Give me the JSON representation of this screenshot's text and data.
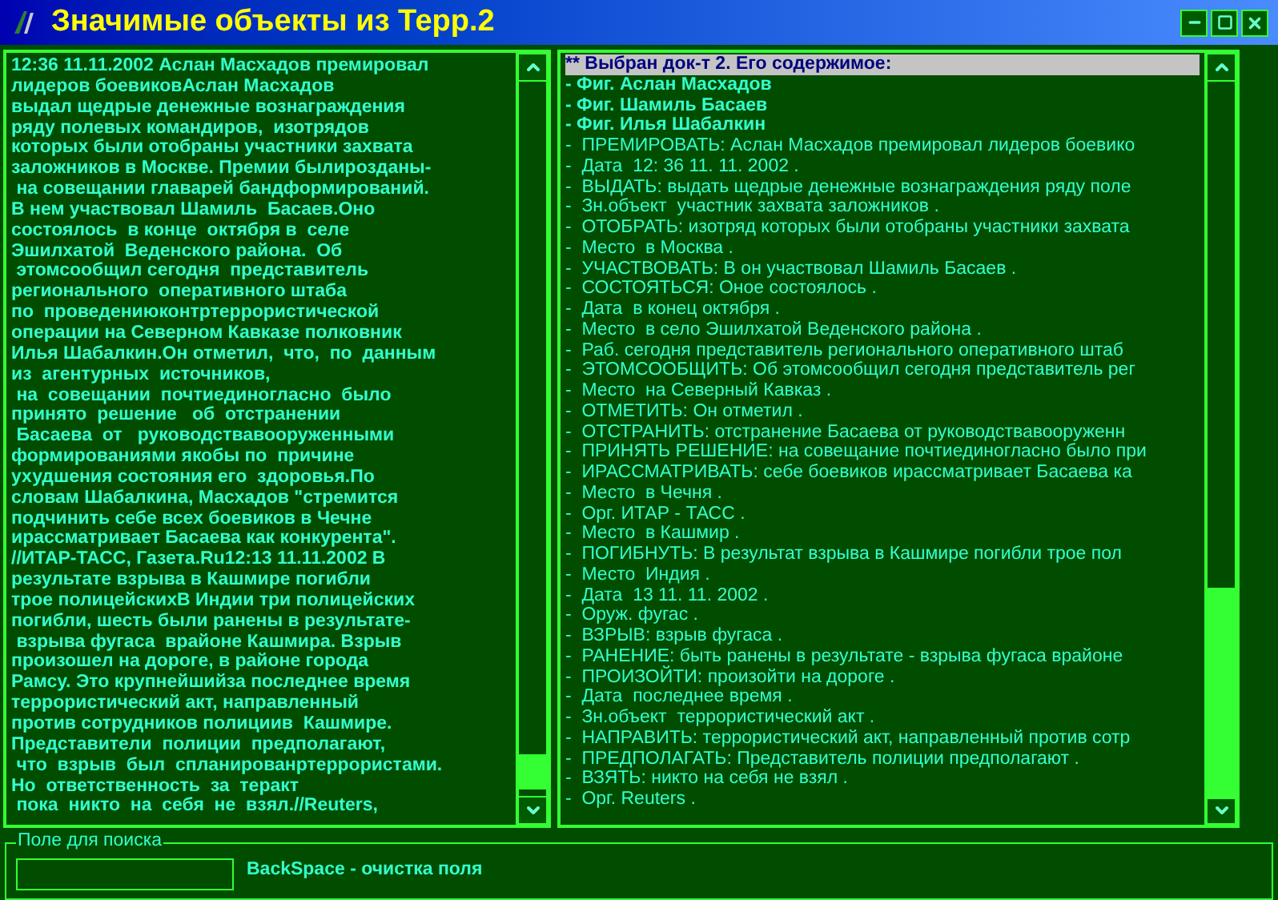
{
  "window": {
    "title": "Значимые объекты из Терр.2"
  },
  "document_text": [
    "12:36 11.11.2002 Аслан Масхадов премировал",
    "лидеров боевиковАслан Масхадов",
    "выдал щедрые денежные вознаграждения",
    "ряду полевых командиров,  изотрядов",
    "которых были отобраны участники захвата",
    "заложников в Москве. Премии былирозданы-",
    " на совещании главарей бандформирований.",
    "В нем участвовал Шамиль  Басаев.Оно",
    "состоялось  в конце  октября в  селе",
    "Эшилхатой  Веденского района.  Об",
    " этомсообщил сегодня  представитель",
    "регионального  оперативного штаба",
    "по  проведениюконтртеррористической",
    "операции на Северном Кавказе полковник",
    "Илья Шабалкин.Он отметил,  что,  по  данным",
    "из  агентурных  источников,",
    " на  совещании  почтиединогласно  было",
    "принято  решение   об  отстранении",
    " Басаева  от   руководствавооруженными",
    "формированиями якобы по  причине",
    "ухудшения состояния его  здоровья.По",
    "словам Шабалкина, Масхадов \"стремится",
    "подчинить себе всех боевиков в Чечне",
    "ирассматривает Басаева как конкурента\".",
    "//ИТАР-ТАСС, Газета.Ru12:13 11.11.2002 В",
    "результате взрыва в Кашмире погибли",
    "трое полицейскихВ Индии три полицейских",
    "погибли, шесть были ранены в результате-",
    " взрыва фугаса  врайоне Кашмира. Взрыв",
    "произошел на дороге, в районе города",
    "Рамсу. Это крупнейшийза последнее время",
    "террористический акт, направленный",
    "против сотрудников полициив  Кашмире.",
    "Представители  полиции  предполагают,",
    " что  взрыв  был  спланированртеррористами.",
    "Но  ответственность  за  теракт",
    " пока  никто  на  себя  не  взял.//Reuters,"
  ],
  "object_list": [
    {
      "kind": "header",
      "text": "** Выбран док-т 2. Его содержимое:",
      "selected": true
    },
    {
      "kind": "figure",
      "text": "- Фиг. Аслан Масхадов",
      "selected": false
    },
    {
      "kind": "figure",
      "text": "- Фиг. Шамиль Басаев",
      "selected": false
    },
    {
      "kind": "figure",
      "text": "- Фиг. Илья Шабалкин",
      "selected": false
    },
    {
      "kind": "fact",
      "text": "-  ПРЕМИРОВАТЬ: Аслан Масхадов премировал лидеров боевико",
      "selected": false
    },
    {
      "kind": "fact",
      "text": "-  Дата  12: 36 11. 11. 2002 .",
      "selected": false
    },
    {
      "kind": "fact",
      "text": "-  ВЫДАТЬ: выдать щедрые денежные вознаграждения ряду поле",
      "selected": false
    },
    {
      "kind": "fact",
      "text": "-  Зн.объект  участник захвата заложников .",
      "selected": false
    },
    {
      "kind": "fact",
      "text": "-  ОТОБРАТЬ: изотряд которых были отобраны участники захвата",
      "selected": false
    },
    {
      "kind": "fact",
      "text": "-  Место  в Москва .",
      "selected": false
    },
    {
      "kind": "fact",
      "text": "-  УЧАСТВОВАТЬ: В он участвовал Шамиль Басаев .",
      "selected": false
    },
    {
      "kind": "fact",
      "text": "-  СОСТОЯТЬСЯ: Оное состоялось .",
      "selected": false
    },
    {
      "kind": "fact",
      "text": "-  Дата  в конец октября .",
      "selected": false
    },
    {
      "kind": "fact",
      "text": "-  Место  в село Эшилхатой Веденского района .",
      "selected": false
    },
    {
      "kind": "fact",
      "text": "-  Раб. сегодня представитель регионального оперативного штаб",
      "selected": false
    },
    {
      "kind": "fact",
      "text": "-  ЭТОМСООБЩИТЬ: Об этомсообщил сегодня представитель рег",
      "selected": false
    },
    {
      "kind": "fact",
      "text": "-  Место  на Северный Кавказ .",
      "selected": false
    },
    {
      "kind": "fact",
      "text": "-  ОТМЕТИТЬ: Он отметил .",
      "selected": false
    },
    {
      "kind": "fact",
      "text": "-  ОТСТРАНИТЬ: отстранение Басаева от руководствавооруженн",
      "selected": false
    },
    {
      "kind": "fact",
      "text": "-  ПРИНЯТЬ РЕШЕНИЕ: на совещание почтиединогласно было при",
      "selected": false
    },
    {
      "kind": "fact",
      "text": "-  ИРАССМАТРИВАТЬ: себе боевиков ирассматривает Басаева ка",
      "selected": false
    },
    {
      "kind": "fact",
      "text": "-  Место  в Чечня .",
      "selected": false
    },
    {
      "kind": "fact",
      "text": "-  Орг. ИТАР - ТАСС .",
      "selected": false
    },
    {
      "kind": "fact",
      "text": "-  Место  в Кашмир .",
      "selected": false
    },
    {
      "kind": "fact",
      "text": "-  ПОГИБНУТЬ: В результат взрыва в Кашмире погибли трое пол",
      "selected": false
    },
    {
      "kind": "fact",
      "text": "-  Место  Индия .",
      "selected": false
    },
    {
      "kind": "fact",
      "text": "-  Дата  13 11. 11. 2002 .",
      "selected": false
    },
    {
      "kind": "fact",
      "text": "-  Оруж. фугас .",
      "selected": false
    },
    {
      "kind": "fact",
      "text": "-  ВЗРЫВ: взрыв фугаса .",
      "selected": false
    },
    {
      "kind": "fact",
      "text": "-  РАНЕНИЕ: быть ранены в результате - взрыва фугаса врайоне",
      "selected": false
    },
    {
      "kind": "fact",
      "text": "-  ПРОИЗОЙТИ: произойти на дороге .",
      "selected": false
    },
    {
      "kind": "fact",
      "text": "-  Дата  последнее время .",
      "selected": false
    },
    {
      "kind": "fact",
      "text": "-  Зн.объект  террористический акт .",
      "selected": false
    },
    {
      "kind": "fact",
      "text": "-  НАПРАВИТЬ: террористический акт, направленный против сотр",
      "selected": false
    },
    {
      "kind": "fact",
      "text": "-  ПРЕДПОЛАГАТЬ: Представитель полиции предполагают .",
      "selected": false
    },
    {
      "kind": "fact",
      "text": "-  ВЗЯТЬ: никто на себя не взял .",
      "selected": false
    },
    {
      "kind": "fact",
      "text": "-  Орг. Reuters .",
      "selected": false
    }
  ],
  "search": {
    "label": "Поле для поиска",
    "hint": "BackSpace - очистка поля"
  }
}
